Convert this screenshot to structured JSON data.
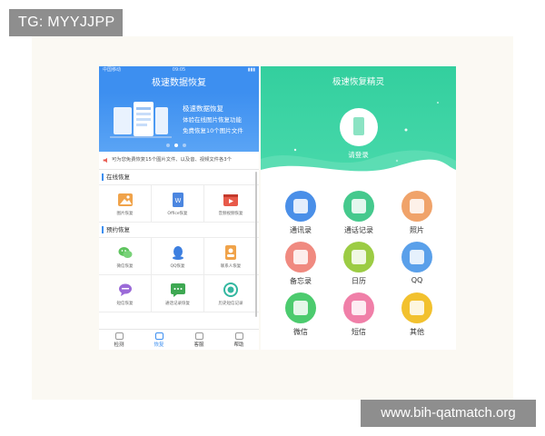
{
  "tag": "TG: MYYJJPP",
  "watermark": "www.bih-qatmatch.org",
  "phone1": {
    "status": {
      "carrier": "中国移动",
      "time": "09:05",
      "battery": "▮▮▮"
    },
    "header_title": "极速数据恢复",
    "banner": {
      "title": "极速数据恢复",
      "line1": "体验在线图片恢复功能",
      "line2": "免费恢复10个图片文件",
      "dots": [
        false,
        true,
        false
      ]
    },
    "notice": "可为您免费恢复15个图片文件、以及音、视频文件各3个",
    "section1_title": "在线恢复",
    "section1_items": [
      {
        "label": "图片恢复",
        "icon": "image-icon",
        "color": "#f0a34a"
      },
      {
        "label": "Office恢复",
        "icon": "document-icon",
        "color": "#4b86e0"
      },
      {
        "label": "音频视频恢复",
        "icon": "video-icon",
        "color": "#e85a4a"
      }
    ],
    "section2_title": "预约恢复",
    "section2_items": [
      {
        "label": "微信恢复",
        "icon": "wechat-icon",
        "color": "#5ec45e"
      },
      {
        "label": "QQ恢复",
        "icon": "qq-icon",
        "color": "#3d7fe0"
      },
      {
        "label": "联系人恢复",
        "icon": "contacts-icon",
        "color": "#f0a34a"
      },
      {
        "label": "短信恢复",
        "icon": "sms-icon",
        "color": "#9b6ad8"
      },
      {
        "label": "通话记录恢复",
        "icon": "call-log-icon",
        "color": "#3ea852"
      },
      {
        "label": "历史短信记录",
        "icon": "history-icon",
        "color": "#33b7a0"
      }
    ],
    "tabs": [
      {
        "label": "检测",
        "icon": "detect-icon",
        "active": false
      },
      {
        "label": "恢复",
        "icon": "recover-icon",
        "active": true
      },
      {
        "label": "客服",
        "icon": "service-icon",
        "active": false
      },
      {
        "label": "帮助",
        "icon": "help-icon",
        "active": false
      }
    ]
  },
  "phone2": {
    "title": "极速恢复精灵",
    "login": "请登录",
    "items": [
      {
        "label": "通讯录",
        "icon": "contacts-icon",
        "color": "#4a8fe8"
      },
      {
        "label": "通话记录",
        "icon": "call-log-icon",
        "color": "#45c98d"
      },
      {
        "label": "照片",
        "icon": "photo-icon",
        "color": "#f0a36a"
      },
      {
        "label": "备忘录",
        "icon": "memo-icon",
        "color": "#f08a80"
      },
      {
        "label": "日历",
        "icon": "calendar-icon",
        "color": "#9ccc44"
      },
      {
        "label": "QQ",
        "icon": "qq-icon",
        "color": "#5aa0ea"
      },
      {
        "label": "微信",
        "icon": "wechat-icon",
        "color": "#4ccb6e"
      },
      {
        "label": "短信",
        "icon": "sms-icon",
        "color": "#f07fa8"
      },
      {
        "label": "其他",
        "icon": "other-icon",
        "color": "#f2c12e"
      }
    ]
  }
}
